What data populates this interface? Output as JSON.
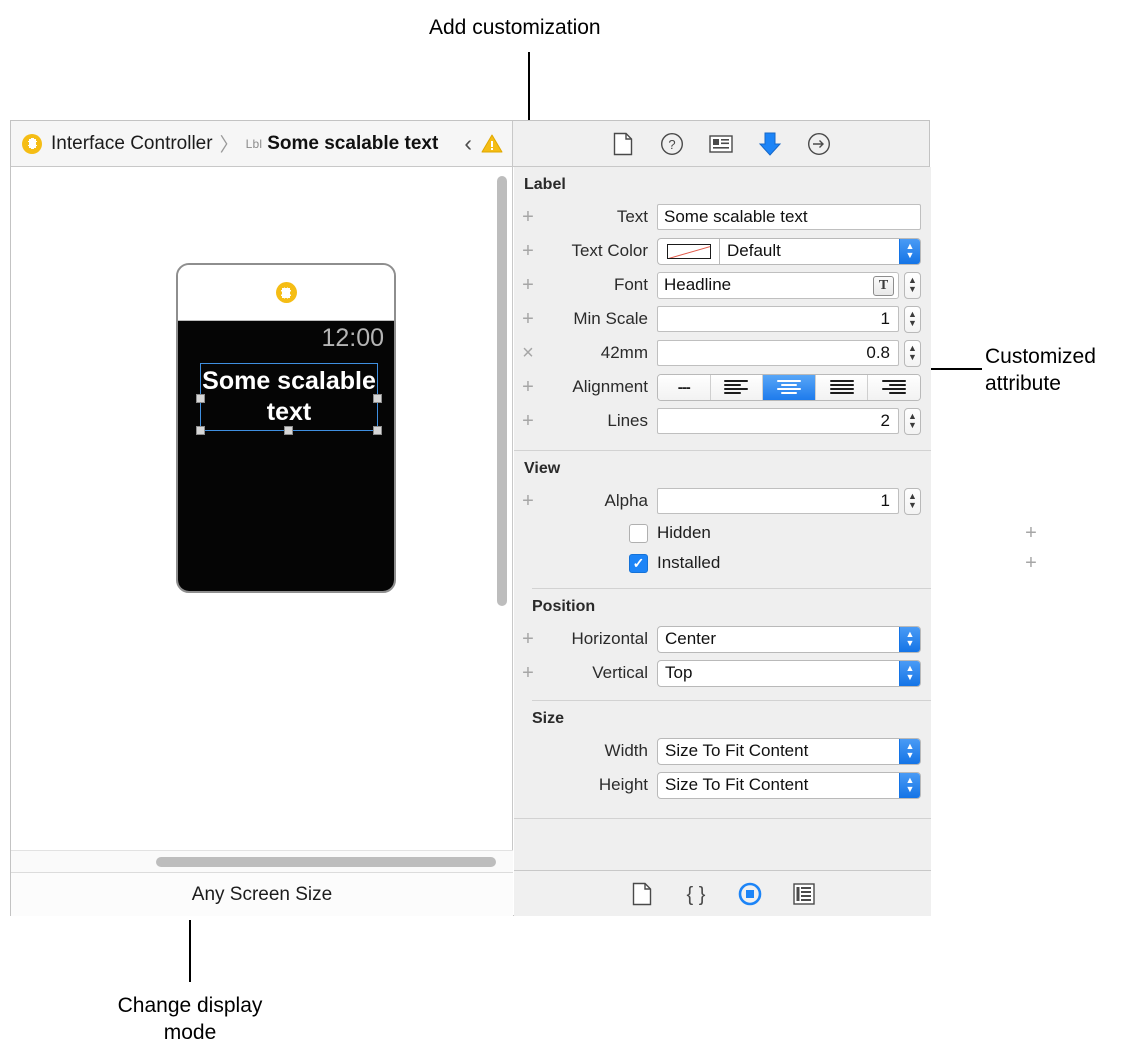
{
  "callouts": [
    {
      "id": "add-customization",
      "text": "Add customization"
    },
    {
      "id": "customized-attribute",
      "text": "Customized\nattribute"
    },
    {
      "id": "change-display-mode",
      "text": "Change display\nmode"
    }
  ],
  "jump_bar": {
    "scene_icon": "interface-controller-icon",
    "scene_label": "Interface Controller",
    "separator": "〉",
    "object_kind": "Lbl",
    "object_label": "Some scalable text",
    "back_arrow": "‹",
    "forward_arrow": "›",
    "warning_icon": "warning-triangle-icon"
  },
  "inspector_tabs": [
    {
      "name": "file-inspector-icon",
      "selected": false
    },
    {
      "name": "quick-help-inspector-icon",
      "selected": false
    },
    {
      "name": "identity-inspector-icon",
      "selected": false
    },
    {
      "name": "attributes-inspector-icon",
      "selected": true
    },
    {
      "name": "connections-inspector-icon",
      "selected": false
    }
  ],
  "canvas": {
    "watch": {
      "status_icon": "interface-controller-icon",
      "time": "12:00",
      "label_text": "Some scalable\ntext"
    },
    "status_bar": {
      "label": "Any Screen Size"
    },
    "vertical_scrollbar": "canvas-vertical-scrollbar",
    "horizontal_scrollbar": "canvas-horizontal-scrollbar"
  },
  "inspector": {
    "sections": [
      {
        "title": "Label",
        "rows": [
          {
            "adorn": "+",
            "label": "Text",
            "kind": "text",
            "value": "Some scalable text"
          },
          {
            "adorn": "+",
            "label": "Text Color",
            "kind": "color",
            "value": "Default",
            "swatch": "no-color-swatch"
          },
          {
            "adorn": "+",
            "label": "Font",
            "kind": "font",
            "value": "Headline",
            "button": "font-picker-icon"
          },
          {
            "adorn": "+",
            "label": "Min Scale",
            "kind": "stepper",
            "value": "1"
          },
          {
            "adorn": "×",
            "label": "42mm",
            "kind": "stepper",
            "value": "0.8"
          },
          {
            "adorn": "+",
            "label": "Alignment",
            "kind": "segmented",
            "segments": [
              "none",
              "left",
              "center",
              "right",
              "justified"
            ],
            "selected_index": 2
          },
          {
            "adorn": "+",
            "label": "Lines",
            "kind": "stepper",
            "value": "2"
          }
        ]
      },
      {
        "title": "View",
        "rows": [
          {
            "adorn": "+",
            "label": "Alpha",
            "kind": "stepper",
            "value": "1"
          },
          {
            "adorn": "+",
            "label": "Hidden",
            "kind": "checkbox",
            "checked": false
          },
          {
            "adorn": "+",
            "label": "Installed",
            "kind": "checkbox",
            "checked": true
          }
        ],
        "subsections": [
          {
            "title": "Position",
            "rows": [
              {
                "adorn": "+",
                "label": "Horizontal",
                "kind": "select",
                "value": "Center"
              },
              {
                "adorn": "+",
                "label": "Vertical",
                "kind": "select",
                "value": "Top"
              }
            ]
          },
          {
            "title": "Size",
            "rows": [
              {
                "adorn": "",
                "label": "Width",
                "kind": "select",
                "value": "Size To Fit Content"
              },
              {
                "adorn": "",
                "label": "Height",
                "kind": "select",
                "value": "Size To Fit Content"
              }
            ]
          }
        ]
      }
    ]
  },
  "inspector_bottom_tabs": [
    {
      "name": "file-template-library-icon",
      "selected": false
    },
    {
      "name": "code-snippet-library-icon",
      "selected": false
    },
    {
      "name": "object-library-icon",
      "selected": true
    },
    {
      "name": "media-library-icon",
      "selected": false
    }
  ],
  "colors": {
    "accent_blue": "#1c84f7",
    "warning_yellow": "#f5bd15",
    "panel_bg": "#efefef"
  }
}
